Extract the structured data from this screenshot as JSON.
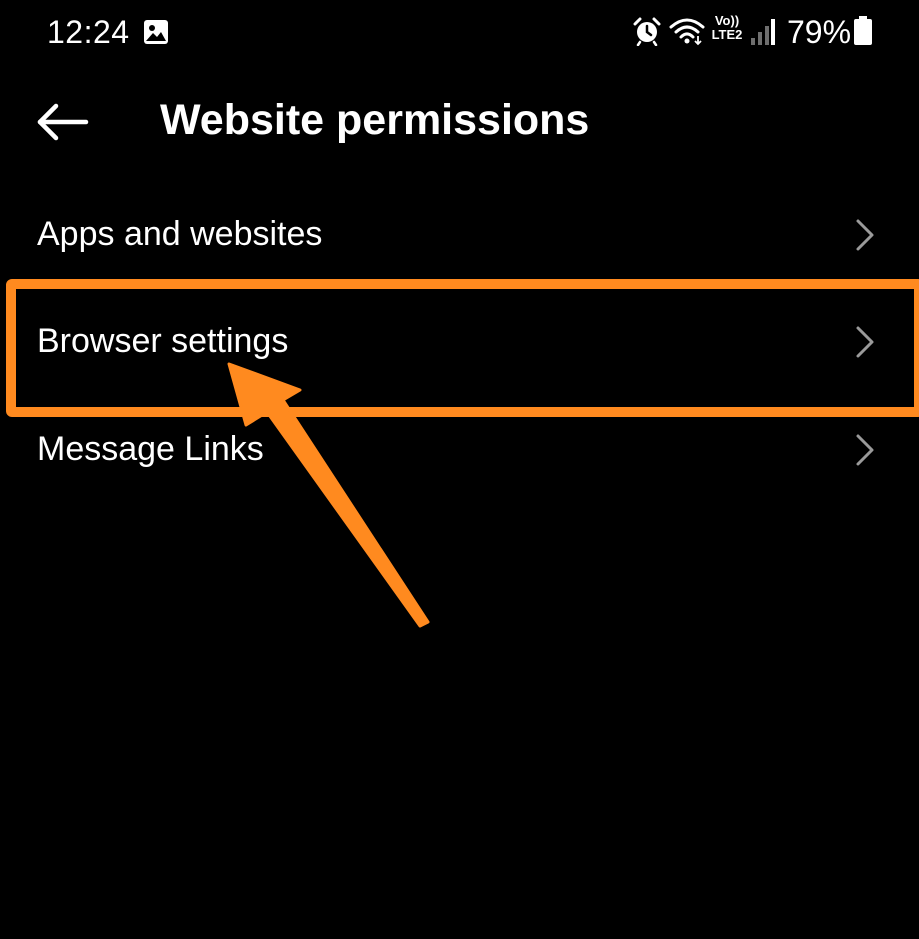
{
  "status_bar": {
    "time": "12:24",
    "gallery_icon": "image-icon",
    "alarm_icon": "alarm-icon",
    "wifi_icon": "wifi-icon",
    "volte_line1": "Vo))",
    "volte_line2": "LTE2",
    "signal_icon": "signal-icon",
    "battery_percent": "79%",
    "battery_icon": "battery-icon"
  },
  "header": {
    "back_icon": "arrow-left-icon",
    "title": "Website permissions"
  },
  "menu": {
    "items": [
      {
        "label": "Apps and websites",
        "icon": "chevron-right-icon"
      },
      {
        "label": "Browser settings",
        "icon": "chevron-right-icon",
        "highlighted": true
      },
      {
        "label": "Message Links",
        "icon": "chevron-right-icon"
      }
    ]
  },
  "colors": {
    "background": "#000000",
    "text": "#ffffff",
    "chevron": "#9a9a9a",
    "annotation": "#ff8a1f"
  }
}
